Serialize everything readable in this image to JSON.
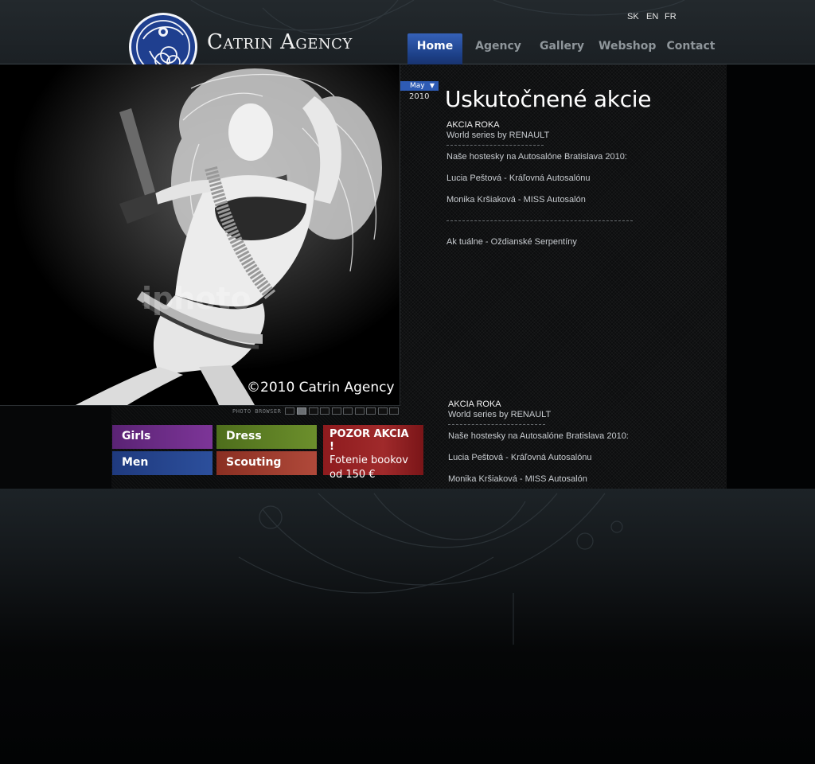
{
  "brand": {
    "name": "Catrin Agency"
  },
  "languages": [
    "SK",
    "EN",
    "FR"
  ],
  "nav": [
    {
      "label": "Home",
      "active": true
    },
    {
      "label": "Agency",
      "active": false
    },
    {
      "label": "Gallery",
      "active": false
    },
    {
      "label": "Webshop",
      "active": false
    },
    {
      "label": "Contact",
      "active": false
    }
  ],
  "photo": {
    "caption": "©2010 Catrin Agency",
    "watermark": "iphoto"
  },
  "photo_browser": {
    "label": "PHOTO BROWSER",
    "count": 10,
    "active_index": 1
  },
  "categories": [
    {
      "label": "Girls",
      "color": "#6f2a8c"
    },
    {
      "label": "Dress",
      "color": "#5d7f24"
    },
    {
      "label": "Men",
      "color": "#243f8a"
    },
    {
      "label": "Scouting",
      "color": "#9a3a2a"
    }
  ],
  "promo": {
    "line1": "POZOR AKCIA !",
    "line2": "Fotenie bookov",
    "line3": "od 150 €",
    "color": "#8e1b1e"
  },
  "archive": {
    "month": "May",
    "year": "2010"
  },
  "article": {
    "title": "Uskutočnené akcie",
    "heading": "AKCIA ROKA",
    "subheading": "World series by RENAULT",
    "line1": "Naše hostesky na Autosalóne Bratislava 2010:",
    "line2": "Lucia Peštová - Kráľovná Autosalónu",
    "line3": "Monika Kršiaková - MISS Autosalón",
    "line4": "Ak tuálne - Oždianské Serpentíny"
  },
  "article_repeat": {
    "heading": "AKCIA ROKA",
    "subheading": "World series by RENAULT",
    "line1": "Naše hostesky na Autosalóne Bratislava 2010:",
    "line2": "Lucia Peštová - Kráľovná Autosalónu",
    "line3": "Monika Kršiaková - MISS Autosalón"
  },
  "colors": {
    "accent": "#2e5bb4",
    "header": "#1f2529",
    "background": "#020304"
  }
}
